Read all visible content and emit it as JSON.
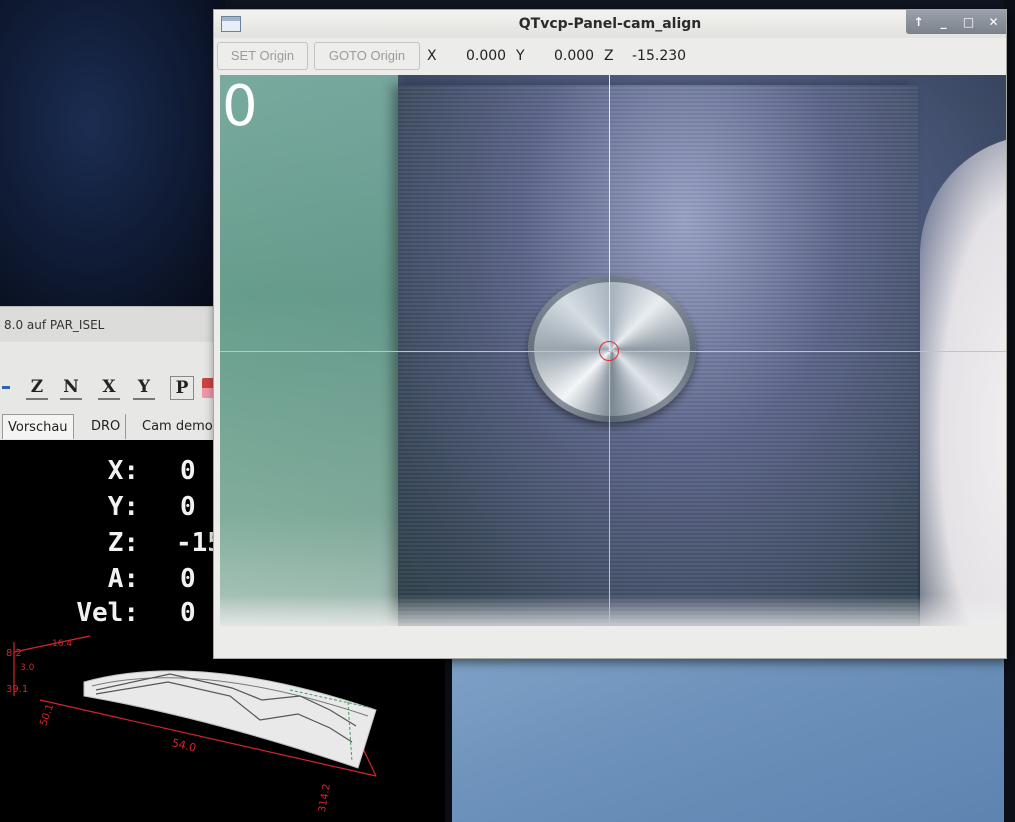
{
  "background_app": {
    "statusbar_text": "8.0 auf  PAR_ISEL",
    "toolbar": {
      "z_label": "Z",
      "n_label": "N",
      "x_label": "X",
      "y_label": "Y",
      "p_label": "P"
    },
    "tabs": [
      {
        "label": "Vorschau"
      },
      {
        "label": "DRO"
      },
      {
        "label": "Cam demo"
      }
    ],
    "dro": {
      "x_label": "X:",
      "x_value": "0",
      "y_label": "Y:",
      "y_value": "0",
      "z_label": "Z:",
      "z_value": "-15",
      "a_label": "A:",
      "a_value": "0",
      "vel_label": "Vel:",
      "vel_value": "0"
    },
    "plot_labels": {
      "dim_a": "8.2",
      "dim_b": "16.4",
      "dim_c": "3.0",
      "dim_d": "39.1",
      "dim_e": "50.1",
      "dim_f": "54.0",
      "dim_g": "314.2"
    },
    "plot_color": "#d6252a"
  },
  "qtvcp_window": {
    "title": "QTvcp-Panel-cam_align",
    "window_controls": {
      "up": "↑",
      "minimize": "_",
      "maximize": "□",
      "close": "✕"
    },
    "set_origin_label": "SET Origin",
    "goto_origin_label": "GOTO Origin",
    "axes": {
      "x_label": "X",
      "x_value": "0.000",
      "y_label": "Y",
      "y_value": "0.000",
      "z_label": "Z",
      "z_value": "-15.230"
    },
    "camera": {
      "overlay_counter": "0",
      "crosshair_color": "#d9d33a",
      "reticle_color": "#e23030"
    }
  }
}
